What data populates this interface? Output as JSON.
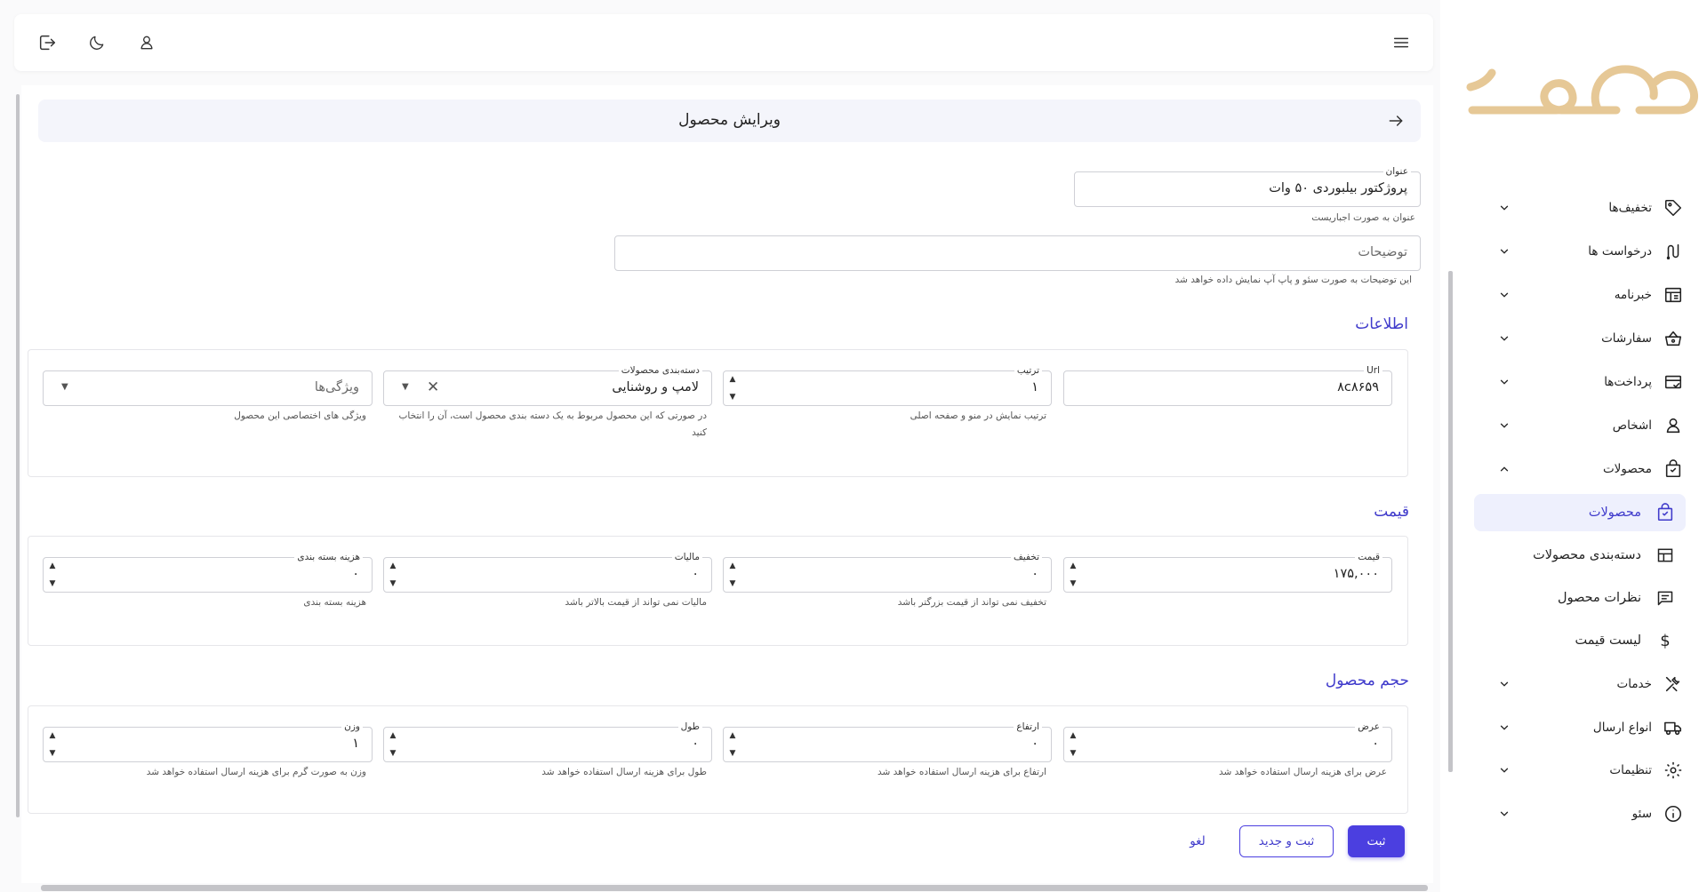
{
  "topbar": {
    "icons": [
      "logout-icon",
      "moon-icon",
      "user-icon",
      "menu-icon"
    ]
  },
  "header": {
    "title": "ویرایش محصول",
    "back_icon": "arrow-right-icon"
  },
  "form": {
    "title_field": {
      "label": "عنوان",
      "value": "پروژکتور بیلبوردی ۵۰ وات",
      "hint": "عنوان به صورت اجباریست"
    },
    "description_field": {
      "placeholder": "توضیحات",
      "hint": "این توضیحات به صورت سئو و پاپ آپ نمایش داده خواهد شد"
    }
  },
  "info_section": {
    "title": "اطلاعات",
    "url": {
      "label": "Url",
      "value": "۸c۸۶۵۹"
    },
    "order": {
      "label": "ترتیب",
      "value": "۱",
      "hint": "ترتیب نمایش در منو و صفحه اصلی"
    },
    "category": {
      "label": "دسته‌بندی محصولات",
      "value": "لامپ و روشنایی",
      "hint": "در صورتی که این محصول مربوط به یک دسته بندی محصول است، آن را انتخاب کنید"
    },
    "features": {
      "placeholder": "ویژگی‌ها",
      "hint": "ویژگی های اختصاصی این محصول"
    }
  },
  "price_section": {
    "title": "قیمت",
    "price": {
      "label": "قیمت",
      "value": "۱۷۵,۰۰۰"
    },
    "discount": {
      "label": "تخفیف",
      "value": "۰",
      "hint": "تخفیف نمی تواند از قیمت بزرگتر باشد"
    },
    "tax": {
      "label": "مالیات",
      "value": "۰",
      "hint": "مالیات نمی تواند از قیمت بالاتر باشد"
    },
    "packaging": {
      "label": "هزینه بسته بندی",
      "value": "۰",
      "hint": "هزینه بسته بندی"
    }
  },
  "size_section": {
    "title": "حجم محصول",
    "width": {
      "label": "عرض",
      "value": "۰",
      "hint": "عرض برای هزینه ارسال استفاده خواهد شد"
    },
    "height": {
      "label": "ارتفاع",
      "value": "۰",
      "hint": "ارتفاع برای هزینه ارسال استفاده خواهد شد"
    },
    "length": {
      "label": "طول",
      "value": "۰",
      "hint": "طول برای هزینه ارسال استفاده خواهد شد"
    },
    "weight": {
      "label": "وزن",
      "value": "۱",
      "hint": "وزن به صورت گرم برای هزینه ارسال استفاده خواهد شد"
    }
  },
  "actions": {
    "submit": "ثبت",
    "submit_new": "ثبت و جدید",
    "cancel": "لغو"
  },
  "sidebar": {
    "items": [
      {
        "label": "تخفیف‌ها",
        "icon": "tag-icon"
      },
      {
        "label": "درخواست ها",
        "icon": "route-icon"
      },
      {
        "label": "خبرنامه",
        "icon": "newspaper-icon"
      },
      {
        "label": "سفارشات",
        "icon": "basket-icon"
      },
      {
        "label": "پرداخت‌ها",
        "icon": "payment-icon"
      },
      {
        "label": "اشخاص",
        "icon": "person-icon"
      },
      {
        "label": "محصولات",
        "icon": "bag-icon"
      }
    ],
    "sub_items": [
      {
        "label": "محصولات",
        "icon": "bag-icon"
      },
      {
        "label": "دسته‌بندی محصولات",
        "icon": "grid-icon"
      },
      {
        "label": "نظرات محصول",
        "icon": "comment-icon"
      },
      {
        "label": "لیست قیمت",
        "icon": "dollar-icon"
      }
    ],
    "items_bottom": [
      {
        "label": "خدمات",
        "icon": "tools-icon"
      },
      {
        "label": "انواع ارسال",
        "icon": "truck-icon"
      },
      {
        "label": "تنظیمات",
        "icon": "settings-icon"
      },
      {
        "label": "سئو",
        "icon": "info-icon"
      }
    ]
  },
  "colors": {
    "accent": "#4b3fe0",
    "logo": "#e6c896",
    "section_title": "#3f3acb"
  }
}
